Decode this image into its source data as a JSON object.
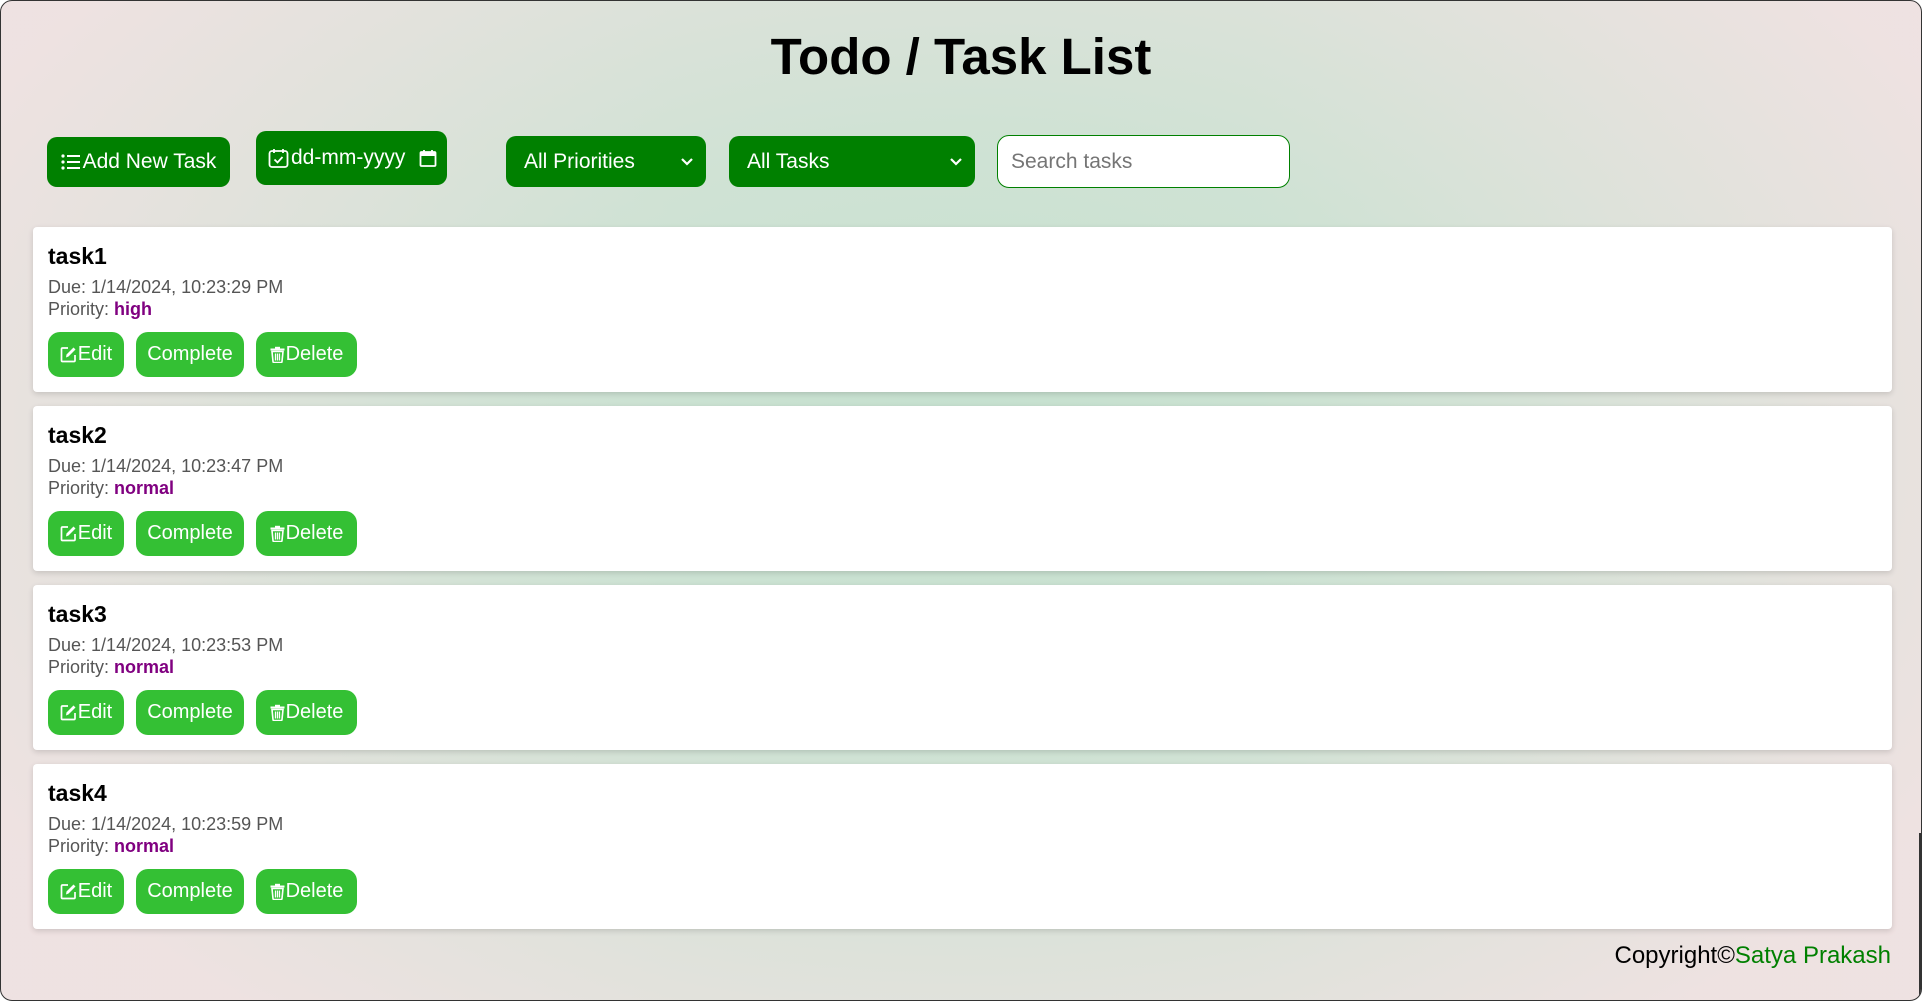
{
  "app": {
    "title": "Todo / Task List"
  },
  "toolbar": {
    "add_label": "Add New Task",
    "date_placeholder": "dd-mm-yyyy",
    "priority_selected": "All Priorities",
    "status_selected": "All Tasks",
    "search_placeholder": "Search tasks"
  },
  "tasks": [
    {
      "title": "task1",
      "due_label": "Due:",
      "due": "1/14/2024, 10:23:29 PM",
      "priority_label": "Priority:",
      "priority": "high"
    },
    {
      "title": "task2",
      "due_label": "Due:",
      "due": "1/14/2024, 10:23:47 PM",
      "priority_label": "Priority:",
      "priority": "normal"
    },
    {
      "title": "task3",
      "due_label": "Due:",
      "due": "1/14/2024, 10:23:53 PM",
      "priority_label": "Priority:",
      "priority": "normal"
    },
    {
      "title": "task4",
      "due_label": "Due:",
      "due": "1/14/2024, 10:23:59 PM",
      "priority_label": "Priority:",
      "priority": "normal"
    }
  ],
  "task_actions": {
    "edit_label": "Edit",
    "complete_label": "Complete",
    "delete_label": "Delete"
  },
  "footer": {
    "copyright_text": "Copyright©",
    "author": "Satya Prakash"
  },
  "colors": {
    "primary_green": "#008000",
    "action_green": "#34c034",
    "priority_purple": "#800080"
  },
  "icons": {
    "add": "list-icon",
    "date": "calendar-check-icon",
    "date_picker": "calendar-icon",
    "dropdown": "chevron-down-icon",
    "edit": "edit-icon",
    "delete": "trash-icon"
  }
}
